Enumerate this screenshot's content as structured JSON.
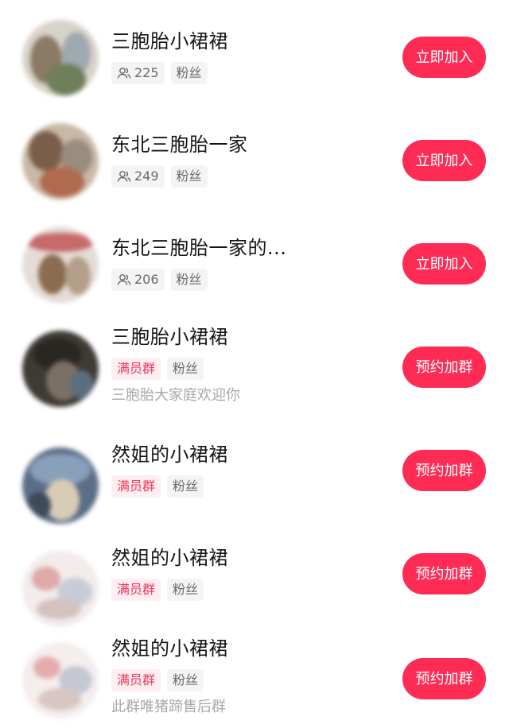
{
  "groups": [
    {
      "title": "三胞胎小裙裙",
      "members": "225",
      "badge": "",
      "fans": "粉丝",
      "desc": "",
      "button": "立即加入"
    },
    {
      "title": "东北三胞胎一家",
      "members": "249",
      "badge": "",
      "fans": "粉丝",
      "desc": "",
      "button": "立即加入"
    },
    {
      "title": "东北三胞胎一家的...",
      "members": "206",
      "badge": "",
      "fans": "粉丝",
      "desc": "",
      "button": "立即加入"
    },
    {
      "title": "三胞胎小裙裙",
      "members": "",
      "badge": "满员群",
      "fans": "粉丝",
      "desc": "三胞胎大家庭欢迎你",
      "button": "预约加群"
    },
    {
      "title": "然姐的小裙裙",
      "members": "",
      "badge": "满员群",
      "fans": "粉丝",
      "desc": "",
      "button": "预约加群"
    },
    {
      "title": "然姐的小裙裙",
      "members": "",
      "badge": "满员群",
      "fans": "粉丝",
      "desc": "",
      "button": "预约加群"
    },
    {
      "title": "然姐的小裙裙",
      "members": "",
      "badge": "满员群",
      "fans": "粉丝",
      "desc": "此群唯猪蹄售后群",
      "button": "预约加群"
    }
  ],
  "colors": {
    "accent": "#fe2c55",
    "full_badge_bg": "#fdeef1",
    "full_badge_text": "#f0365f",
    "tag_bg": "#f4f4f5"
  },
  "icons": {
    "members": "people-icon"
  }
}
